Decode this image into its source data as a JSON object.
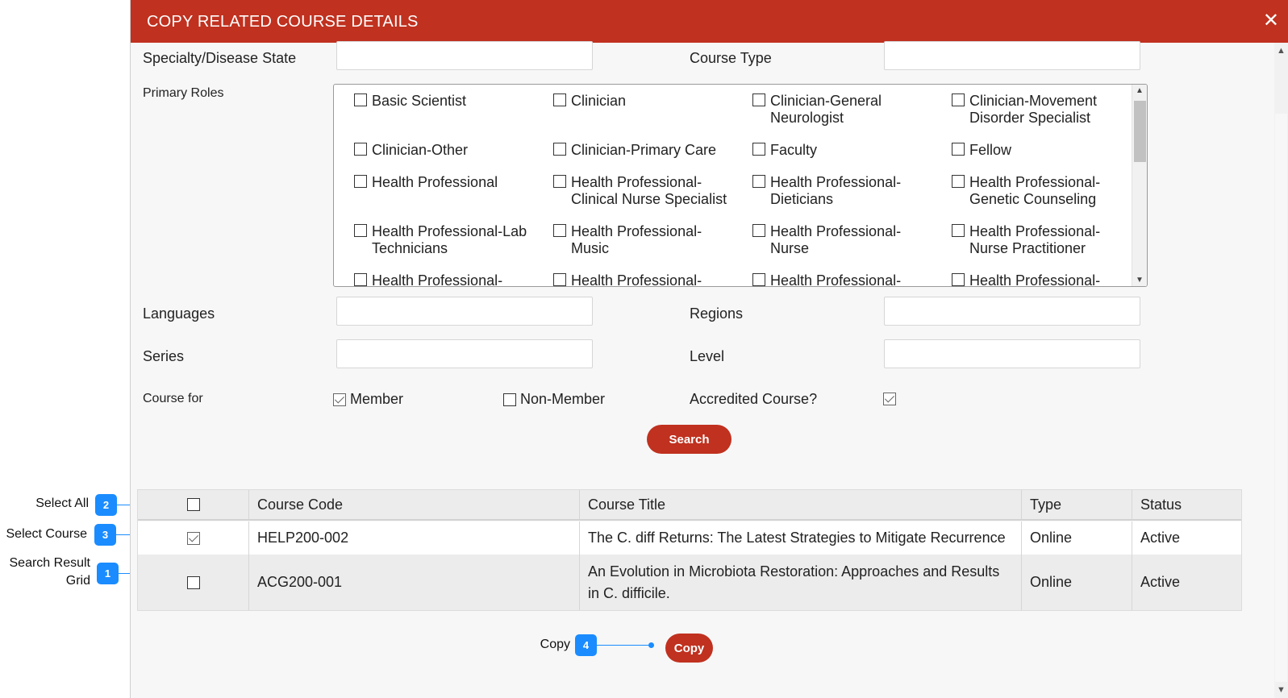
{
  "modal": {
    "title": "COPY RELATED COURSE DETAILS",
    "close_icon": "close-icon"
  },
  "filters": {
    "specialty_label": "Specialty/Disease State",
    "specialty_value": "",
    "course_type_label": "Course Type",
    "course_type_value": "",
    "primary_roles_label": "Primary Roles",
    "languages_label": "Languages",
    "languages_value": "",
    "regions_label": "Regions",
    "regions_value": "",
    "series_label": "Series",
    "series_value": "",
    "level_label": "Level",
    "level_value": "",
    "course_for_label": "Course for",
    "member_label": "Member",
    "member_checked": true,
    "non_member_label": "Non-Member",
    "non_member_checked": false,
    "accredited_label": "Accredited Course?",
    "accredited_checked": true,
    "search_button": "Search"
  },
  "roles": [
    {
      "line1": "Basic Scientist",
      "line2": "",
      "checked": false
    },
    {
      "line1": "Clinician",
      "line2": "",
      "checked": false
    },
    {
      "line1": "Clinician-General",
      "line2": "Neurologist",
      "checked": false
    },
    {
      "line1": "Clinician-Movement",
      "line2": "Disorder Specialist",
      "checked": false
    },
    {
      "line1": "Clinician-Other",
      "line2": "",
      "checked": false
    },
    {
      "line1": "Clinician-Primary Care",
      "line2": "",
      "checked": false
    },
    {
      "line1": "Faculty",
      "line2": "",
      "checked": false
    },
    {
      "line1": "Fellow",
      "line2": "",
      "checked": false
    },
    {
      "line1": "Health Professional",
      "line2": "",
      "checked": false
    },
    {
      "line1": "Health Professional-",
      "line2": "Clinical Nurse Specialist",
      "checked": false
    },
    {
      "line1": "Health Professional-",
      "line2": "Dieticians",
      "checked": false
    },
    {
      "line1": "Health Professional-",
      "line2": "Genetic Counseling",
      "checked": false
    },
    {
      "line1": "Health Professional-Lab",
      "line2": "Technicians",
      "checked": false
    },
    {
      "line1": "Health Professional-",
      "line2": "Music",
      "checked": false
    },
    {
      "line1": "Health Professional-",
      "line2": "Nurse",
      "checked": false
    },
    {
      "line1": "Health Professional-",
      "line2": "Nurse Practitioner",
      "checked": false
    },
    {
      "line1": "Health Professional-",
      "line2": "",
      "checked": false
    },
    {
      "line1": "Health Professional-",
      "line2": "",
      "checked": false
    },
    {
      "line1": "Health Professional-",
      "line2": "",
      "checked": false
    },
    {
      "line1": "Health Professional-",
      "line2": "",
      "checked": false
    }
  ],
  "grid": {
    "headers": [
      "Course Code",
      "Course Title",
      "Type",
      "Status"
    ],
    "select_all_checked": false,
    "rows": [
      {
        "checked": true,
        "code": "HELP200-002",
        "title": "The C. diff Returns: The Latest Strategies to Mitigate Recurrence",
        "type": "Online",
        "status": "Active"
      },
      {
        "checked": false,
        "code": "ACG200-001",
        "title": "An Evolution in Microbiota Restoration: Approaches and Results in C. difficile.",
        "type": "Online",
        "status": "Active"
      }
    ]
  },
  "copy_button": "Copy",
  "callouts": {
    "select_all": {
      "label": "Select All",
      "number": "2"
    },
    "select_course": {
      "label": "Select Course",
      "number": "3"
    },
    "search_result": {
      "label_line1": "Search Result",
      "label_line2": "Grid",
      "number": "1"
    },
    "copy": {
      "label": "Copy",
      "number": "4"
    }
  },
  "colors": {
    "brand_red": "#c0311f",
    "callout_blue": "#1a8cff"
  }
}
